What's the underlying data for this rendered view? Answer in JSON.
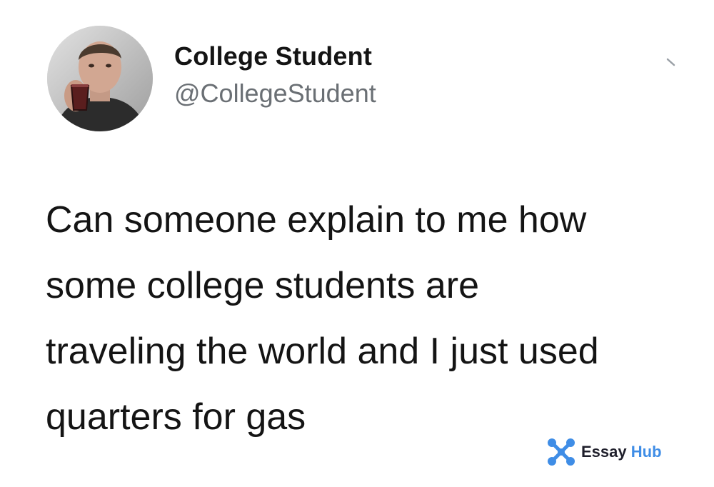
{
  "tweet": {
    "author": {
      "name": "College Student",
      "handle": "@CollegeStudent",
      "avatar_icon": "avatar-photo"
    },
    "menu_icon": "chevron-down-icon",
    "text_lines": [
      "Can someone explain to me how",
      "some college students are",
      "traveling the world and I just used",
      "quarters for gas"
    ]
  },
  "watermark": {
    "brand_first": "Essay",
    "brand_second": "Hub",
    "logo_icon": "essayhub-logo",
    "colors": {
      "blue": "#3f8de6",
      "dark": "#1f1f2b"
    }
  }
}
